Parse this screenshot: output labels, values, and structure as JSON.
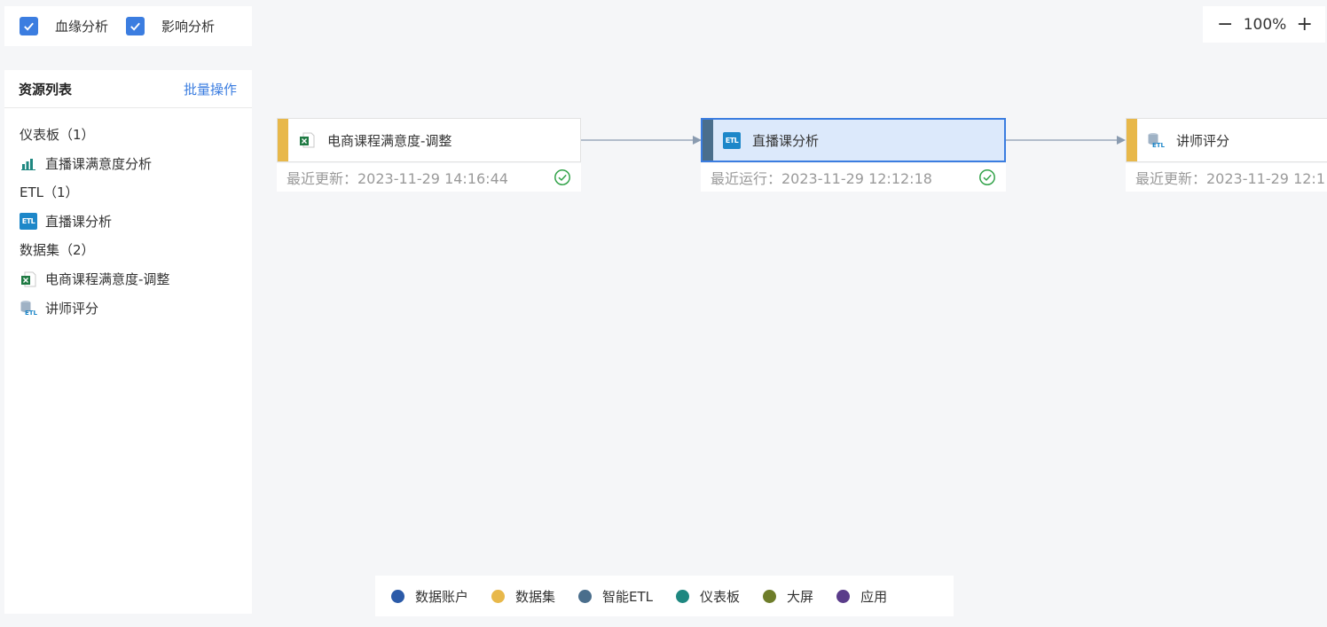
{
  "toggles": {
    "lineage": {
      "label": "血缘分析",
      "checked": true
    },
    "impact": {
      "label": "影响分析",
      "checked": true
    }
  },
  "zoom": {
    "minus": "−",
    "level": "100%",
    "plus": "+"
  },
  "resources": {
    "title": "资源列表",
    "batch": "批量操作",
    "groups": [
      {
        "label": "仪表板（1）",
        "items": [
          {
            "label": "直播课满意度分析",
            "icon": "dashboard-icon"
          }
        ]
      },
      {
        "label": "ETL（1）",
        "items": [
          {
            "label": "直播课分析",
            "icon": "etl-icon"
          }
        ]
      },
      {
        "label": "数据集（2）",
        "items": [
          {
            "label": "电商课程满意度-调整",
            "icon": "excel-icon"
          },
          {
            "label": "讲师评分",
            "icon": "etl-dataset-icon"
          }
        ]
      }
    ]
  },
  "nodes": [
    {
      "label": "电商课程满意度-调整",
      "meta": "最近更新：2023-11-29 14:16:44",
      "status": "success",
      "accent": "#e8b84a",
      "icon": "excel-icon"
    },
    {
      "label": "直播课分析",
      "meta": "最近运行：2023-11-29 12:12:18",
      "status": "success",
      "accent": "#4a6e8c",
      "icon": "etl-icon"
    },
    {
      "label": "讲师评分",
      "meta": "最近更新：2023-11-29 12:1",
      "accent": "#e8b84a",
      "icon": "etl-dataset-icon"
    }
  ],
  "legend": [
    {
      "label": "数据账户",
      "color": "#2b5aa8"
    },
    {
      "label": "数据集",
      "color": "#e8b84a"
    },
    {
      "label": "智能ETL",
      "color": "#4a6e8c"
    },
    {
      "label": "仪表板",
      "color": "#1e8780"
    },
    {
      "label": "大屏",
      "color": "#6e7d2a"
    },
    {
      "label": "应用",
      "color": "#5a3c8a"
    }
  ]
}
